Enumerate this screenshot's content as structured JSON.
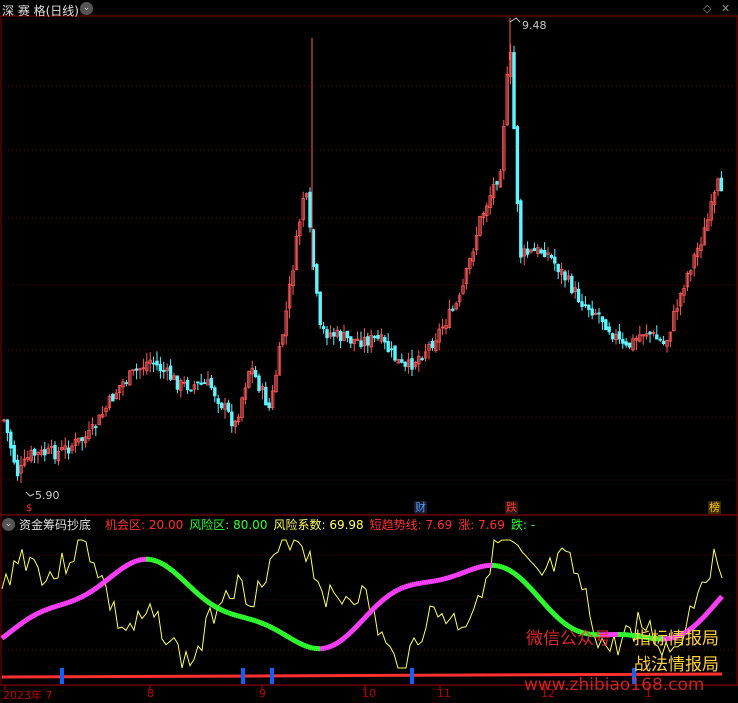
{
  "header": {
    "title": "深 赛 格(日线)",
    "collapse_glyph": "⌄"
  },
  "price_panel": {
    "high_label": "9.48",
    "low_label": "5.90",
    "event_markers": [
      {
        "text": "财",
        "color": "#4aa0ff"
      },
      {
        "text": "跌",
        "color": "#ff3030"
      },
      {
        "text": "榜",
        "color": "#ffcc00"
      }
    ],
    "dividend_marker": "$"
  },
  "indicator": {
    "name": "资金筹码抄底",
    "params": [
      {
        "label": "机会区: ",
        "value": "20.00",
        "color": "#ff3030"
      },
      {
        "label": "风险区: ",
        "value": "80.00",
        "color": "#30ff30"
      },
      {
        "label": "风险系数: ",
        "value": "69.98",
        "color": "#ffff60"
      },
      {
        "label": "短趋势线: ",
        "value": "7.69",
        "color": "#ff3030"
      },
      {
        "label": "涨: ",
        "value": "7.69",
        "color": "#ff3030"
      },
      {
        "label": "跌: ",
        "value": "-",
        "color": "#30ff30"
      }
    ]
  },
  "time_axis": {
    "labels": [
      "2023年 7",
      "8",
      "9",
      "10",
      "11",
      "12",
      "1"
    ]
  },
  "watermarks": {
    "line1_left": "微信公众号",
    "line1_right": "指标情报局",
    "line2": "战法情报局",
    "url": "www.zhibiao168.com"
  },
  "colors": {
    "up": "#ff5a5a",
    "down": "#5ff4ff",
    "grid": "#5a0000",
    "accent_red": "#ff3030",
    "green": "#30ff30",
    "magenta": "#ff40ff",
    "yellow": "#ffff60"
  }
}
